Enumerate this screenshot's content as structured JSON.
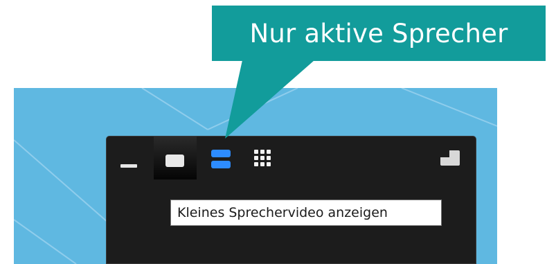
{
  "callout": {
    "text": "Nur aktive Sprecher",
    "background_color": "#129c9b",
    "text_color": "#ffffff"
  },
  "background": {
    "color": "#5fb8e1"
  },
  "toolbar": {
    "buttons": [
      {
        "id": "minimize",
        "icon": "minimize-icon",
        "active": false
      },
      {
        "id": "single-video",
        "icon": "single-video-icon",
        "active": true
      },
      {
        "id": "active-speaker",
        "icon": "active-speaker-icon",
        "active": false,
        "highlight_color": "#2d8cff"
      },
      {
        "id": "gallery",
        "icon": "gallery-grid-icon",
        "active": false
      },
      {
        "id": "exit-mini",
        "icon": "picture-in-picture-icon",
        "active": false
      }
    ]
  },
  "tooltip": {
    "text": "Kleines Sprechervideo anzeigen"
  }
}
